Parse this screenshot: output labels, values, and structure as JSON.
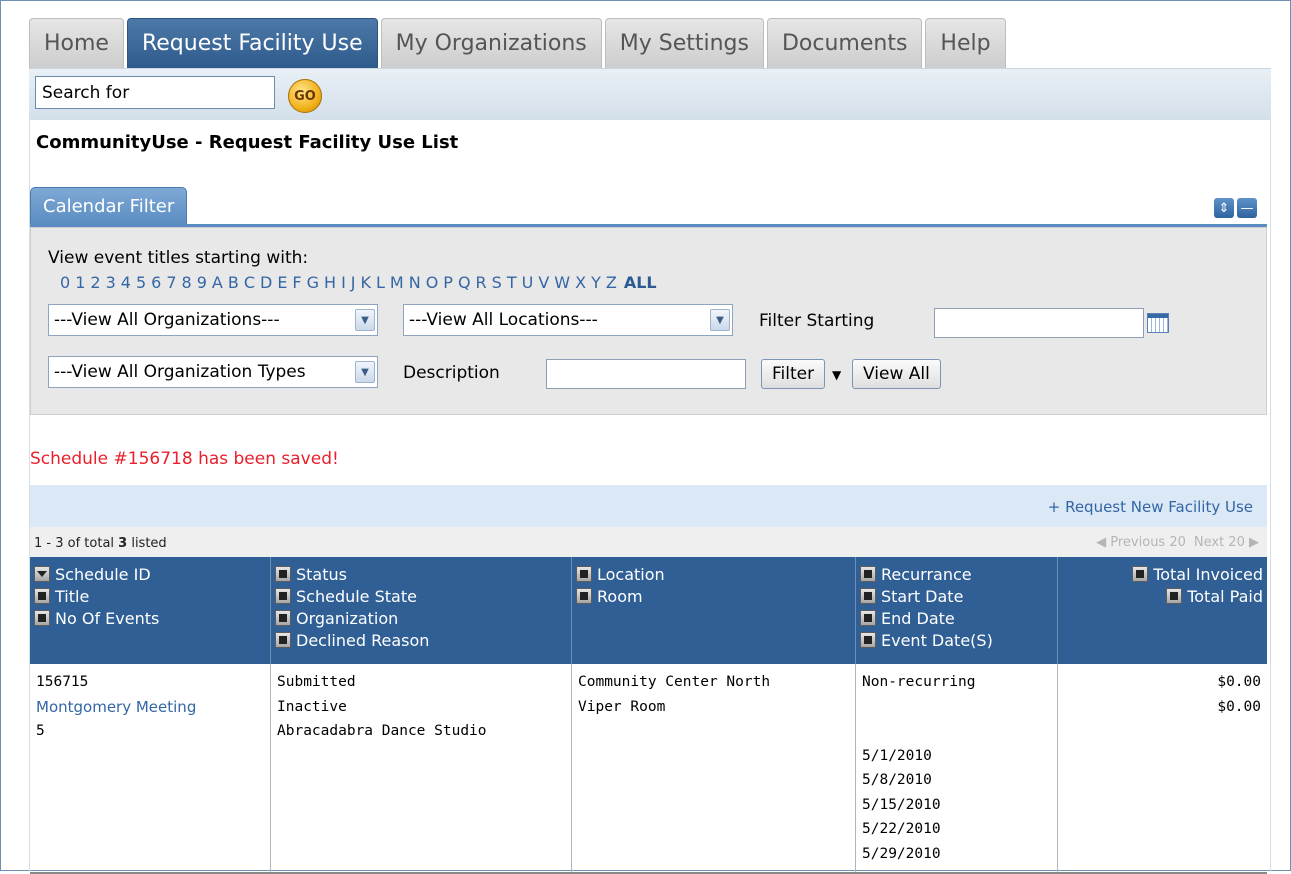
{
  "tabs": [
    "Home",
    "Request Facility Use",
    "My Organizations",
    "My Settings",
    "Documents",
    "Help"
  ],
  "search": {
    "value": "Search for",
    "go_label": "GO"
  },
  "page_title": "CommunityUse - Request Facility Use List",
  "filter": {
    "tab_label": "Calendar Filter",
    "view_label": "View event titles starting with:",
    "letters": [
      "0",
      "1",
      "2",
      "3",
      "4",
      "5",
      "6",
      "7",
      "8",
      "9",
      "A",
      "B",
      "C",
      "D",
      "E",
      "F",
      "G",
      "H",
      "I",
      "J",
      "K",
      "L",
      "M",
      "N",
      "O",
      "P",
      "Q",
      "R",
      "S",
      "T",
      "U",
      "V",
      "W",
      "X",
      "Y",
      "Z"
    ],
    "all_label": "ALL",
    "org_select": "---View All Organizations---",
    "location_select": "---View All Locations---",
    "filter_starting_label": "Filter Starting",
    "org_type_select": "---View All Organization Types",
    "description_label": "Description",
    "filter_button": "Filter",
    "view_all_button": "View All"
  },
  "message": "Schedule #156718 has been saved!",
  "actions": {
    "request_new": "+ Request New Facility Use"
  },
  "pager": {
    "count_prefix": "1 - 3 of total ",
    "total": "3",
    "count_suffix": " listed",
    "previous": "Previous 20",
    "next": "Next 20"
  },
  "columns": {
    "c1": [
      "Schedule ID",
      "Title",
      "No Of Events"
    ],
    "c2": [
      "Status",
      "Schedule State",
      "Organization",
      "Declined Reason"
    ],
    "c3": [
      "Location",
      "Room"
    ],
    "c4": [
      "Recurrance",
      "Start Date",
      "End Date",
      "Event Date(S)"
    ],
    "c5": [
      "Total Invoiced",
      "Total Paid"
    ]
  },
  "rows": [
    {
      "schedule_id": "156715",
      "title": "Montgomery Meeting",
      "events": "5",
      "status": "Submitted",
      "state": "Inactive",
      "organization": "Abracadabra Dance Studio",
      "location": "Community Center North",
      "room": "Viper Room",
      "recurrence": "Non-recurring",
      "event_dates": [
        "5/1/2010",
        "5/8/2010",
        "5/15/2010",
        "5/22/2010",
        "5/29/2010"
      ],
      "total_invoiced": "$0.00",
      "total_paid": "$0.00"
    }
  ]
}
